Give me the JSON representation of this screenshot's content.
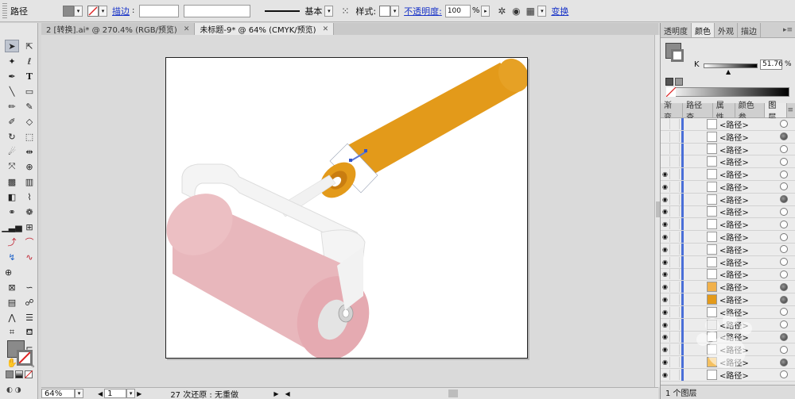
{
  "control_bar": {
    "selection_label": "路径",
    "stroke_link": "描边",
    "stroke_profile": "基本",
    "style_label": "样式:",
    "opacity_link": "不透明度:",
    "opacity_value": "100",
    "opacity_unit": "%",
    "transform_link": "变换"
  },
  "doc_tabs": [
    {
      "label": "2 [转换].ai* @ 270.4% (RGB/预览)",
      "active": false
    },
    {
      "label": "未标题-9* @ 64% (CMYK/预览)",
      "active": true
    }
  ],
  "tool_icons": [
    "selection-arrow",
    "direct-select",
    "magic-wand",
    "lasso",
    "pen",
    "type",
    "line",
    "rectangle",
    "paintbrush",
    "pencil",
    "blob-brush",
    "eraser",
    "rotate",
    "scale",
    "warp",
    "width",
    "free-transform",
    "shape-builder",
    "perspective",
    "mesh",
    "gradient",
    "eyedropper",
    "blend",
    "symbol-sprayer",
    "column-graph",
    "artboard",
    "slice",
    "hand",
    "zoom"
  ],
  "color_panel": {
    "tabs": [
      "透明度",
      "颜色",
      "外观",
      "描边"
    ],
    "active_tab": "颜色",
    "channel": "K",
    "value": "51.76",
    "unit": "%"
  },
  "layers_panel": {
    "tabs": [
      "渐变",
      "路径查",
      "属性",
      "颜色参",
      "图层"
    ],
    "active_tab": "图层",
    "item_name": "<路径>",
    "footer": "1 个图层"
  },
  "status_bar": {
    "zoom": "64%",
    "page": "1",
    "undo_text": "27 次还原 : 无重做"
  },
  "colors": {
    "handle": "#e39a1a",
    "roller": "#e8b7bc",
    "frame": "#f3f3f3"
  }
}
